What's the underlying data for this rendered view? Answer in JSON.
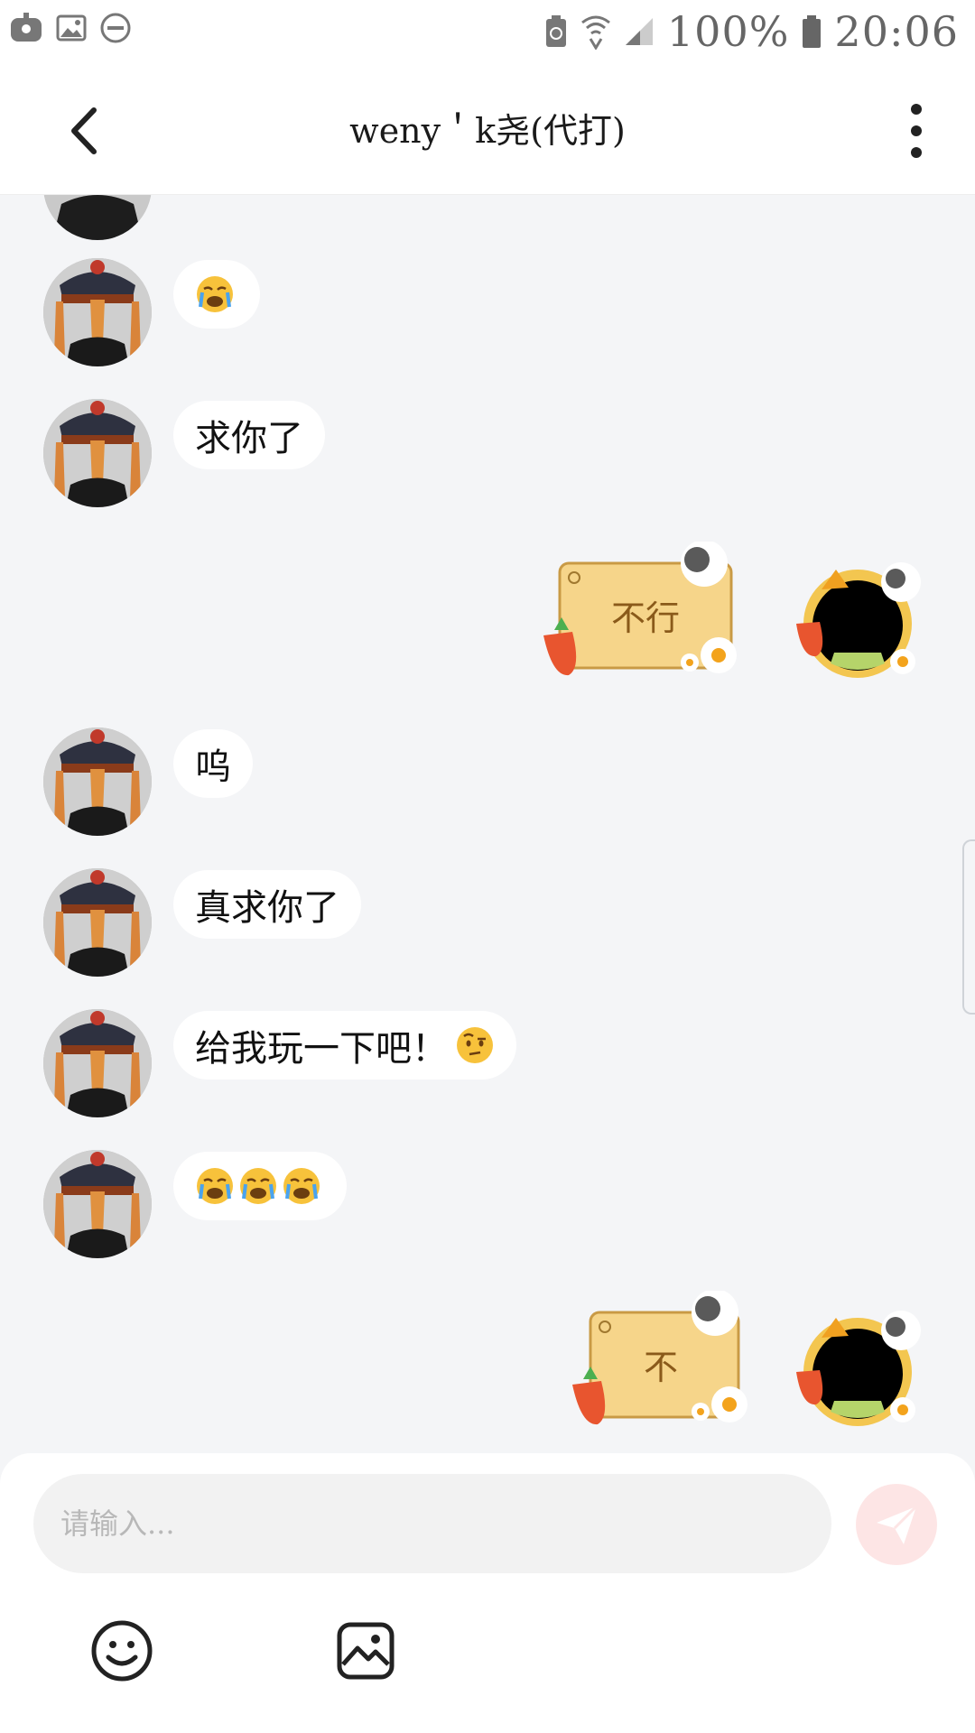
{
  "status_bar": {
    "battery_percent": "100%",
    "time": "20:06",
    "icons": [
      "game-icon",
      "gallery-icon",
      "dnd-icon",
      "recycle-battery-icon",
      "wifi-icon",
      "signal-icon",
      "battery-icon"
    ]
  },
  "header": {
    "title": "weny＇k尧(代打)",
    "back_icon": "chevron-left-icon",
    "more_icon": "more-vertical-icon"
  },
  "messages": [
    {
      "side": "in",
      "text": "",
      "emoji": [
        "loudly-crying"
      ]
    },
    {
      "side": "in",
      "text": "求你了"
    },
    {
      "side": "out",
      "sticker_text": "不行"
    },
    {
      "side": "in",
      "text": "呜"
    },
    {
      "side": "in",
      "text": "真求你了"
    },
    {
      "side": "in",
      "text": "给我玩一下吧！",
      "emoji": [
        "raised-eyebrow"
      ]
    },
    {
      "side": "in",
      "text": "",
      "emoji": [
        "loudly-crying",
        "loudly-crying",
        "loudly-crying"
      ]
    },
    {
      "side": "out",
      "sticker_text": "不"
    }
  ],
  "composer": {
    "placeholder": "请输入...",
    "send_icon": "paper-plane-icon",
    "emoji_icon": "smiley-icon",
    "image_icon": "image-icon"
  },
  "colors": {
    "chat_bg": "#f4f5f7",
    "bubble_bg": "#ffffff",
    "send_bg": "#fde5e5",
    "send_icon": "#ffffff",
    "sticker_board": "#f6d58a"
  }
}
